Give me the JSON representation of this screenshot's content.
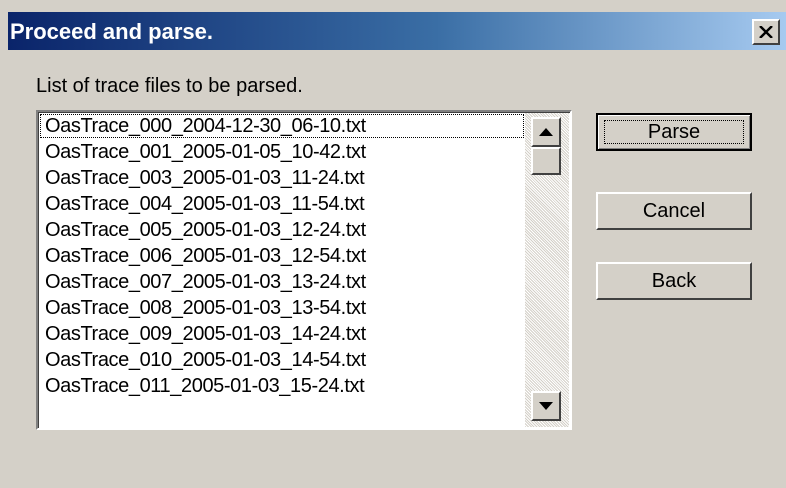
{
  "window": {
    "title": "Proceed and parse."
  },
  "list": {
    "caption": "List of trace files to be parsed.",
    "items": [
      "OasTrace_000_2004-12-30_06-10.txt",
      "OasTrace_001_2005-01-05_10-42.txt",
      "OasTrace_003_2005-01-03_11-24.txt",
      "OasTrace_004_2005-01-03_11-54.txt",
      "OasTrace_005_2005-01-03_12-24.txt",
      "OasTrace_006_2005-01-03_12-54.txt",
      "OasTrace_007_2005-01-03_13-24.txt",
      "OasTrace_008_2005-01-03_13-54.txt",
      "OasTrace_009_2005-01-03_14-24.txt",
      "OasTrace_010_2005-01-03_14-54.txt",
      "OasTrace_011_2005-01-03_15-24.txt"
    ]
  },
  "buttons": {
    "parse": "Parse",
    "cancel": "Cancel",
    "back": "Back"
  },
  "icons": {
    "close": "close-icon",
    "scroll_up": "arrow-up-icon",
    "scroll_down": "arrow-down-icon"
  },
  "colors": {
    "titlebar_start": "#0a246a",
    "titlebar_end": "#a6caf0",
    "face": "#d4d0c8"
  }
}
